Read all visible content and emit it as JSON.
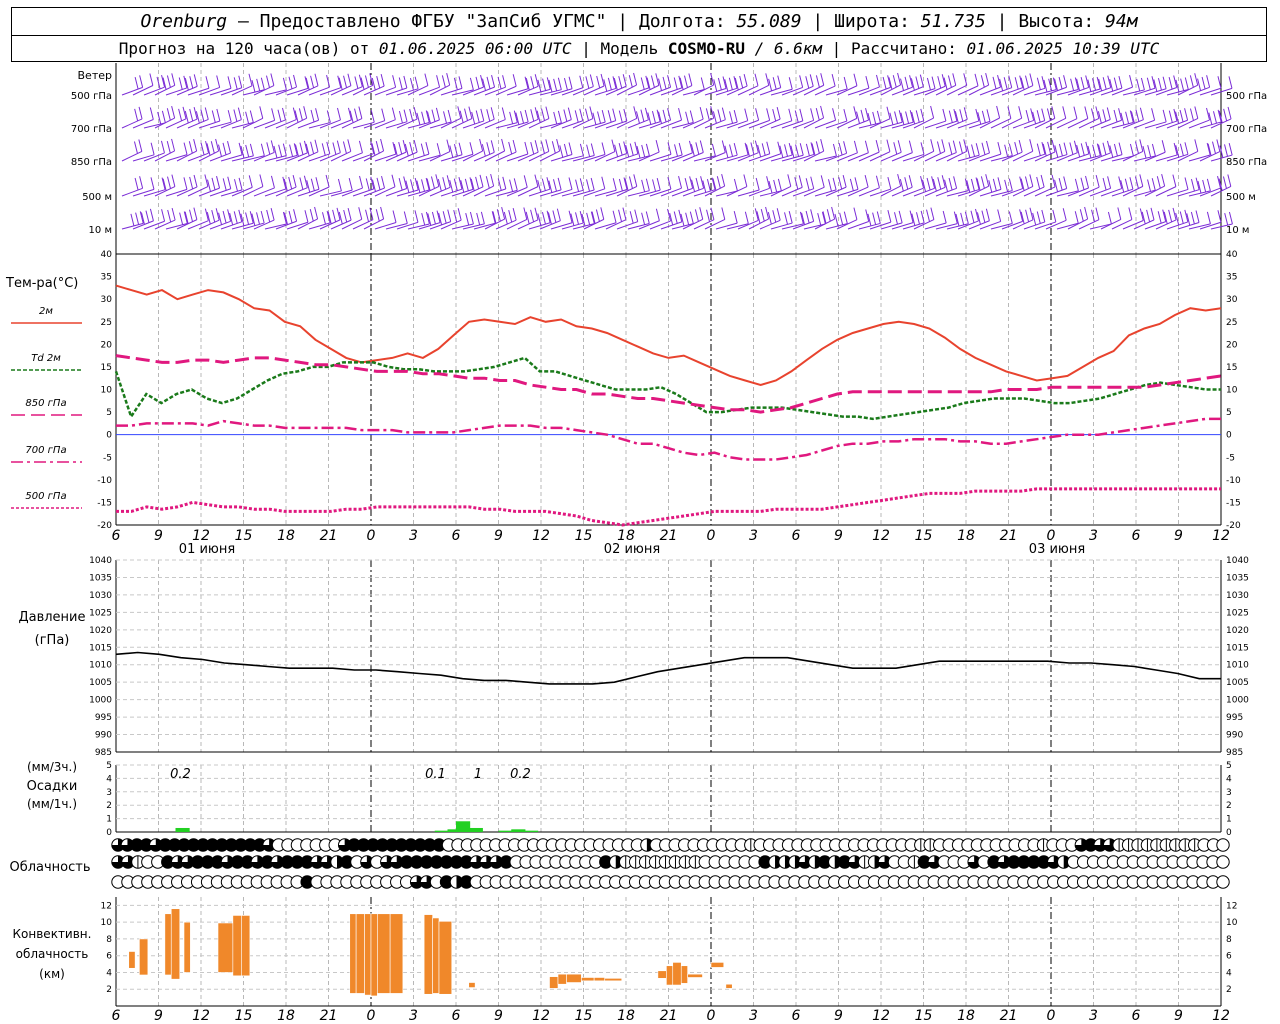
{
  "header": {
    "station": "Orenburg",
    "provider": "— Предоставлено ФГБУ \"ЗапСиб УГМС\"",
    "lon_label": "| Долгота:",
    "lon": "55.089",
    "lat_label": "| Широта:",
    "lat": "51.735",
    "alt_label": "| Высота:",
    "alt": "94м",
    "fc_label": "Прогноз на 120 часа(ов) от",
    "fc_time": "01.06.2025 06:00 UTC",
    "model_label": "| Модель",
    "model": "COSMO-RU",
    "model_res": "/ 6.6км",
    "calc_label": "| Рассчитано:",
    "calc_time": "01.06.2025 10:39 UTC"
  },
  "colors": {
    "wind": "#7b2cd6",
    "t2m": "#e8432e",
    "td2m": "#1a7a1a",
    "t850": "#e0187f",
    "t700": "#e0187f",
    "t500": "#e0187f",
    "pressure": "#000000",
    "precip": "#22d022",
    "convective": "#f0882a",
    "zero_line": "#3344ff"
  },
  "chart_data": {
    "type": "line",
    "x_ticks": [
      "6",
      "9",
      "12",
      "15",
      "18",
      "21",
      "0",
      "3",
      "6",
      "9",
      "12",
      "15",
      "18",
      "21",
      "0",
      "3",
      "6",
      "9",
      "12",
      "15",
      "18",
      "21",
      "0",
      "3",
      "6",
      "9",
      "12"
    ],
    "day_labels": [
      "01 июня",
      "02 июня",
      "03 июня"
    ],
    "wind": {
      "title": "Ветер",
      "levels": [
        "500 гПа",
        "700 гПа",
        "850 гПа",
        "500 м",
        "10 м"
      ]
    },
    "temperature": {
      "title": "Тем-ра(°C)",
      "ylim": [
        -20,
        40
      ],
      "y_ticks": [
        40,
        35,
        30,
        25,
        20,
        15,
        10,
        5,
        0,
        -5,
        -10,
        -15,
        -20
      ],
      "series": [
        {
          "name": "2м",
          "key": "t2m",
          "values": [
            33,
            32,
            31,
            32,
            30,
            31,
            32,
            31.5,
            30,
            28,
            27.5,
            25,
            24,
            21,
            19,
            17,
            16,
            16.5,
            17,
            18,
            17,
            19,
            22,
            25,
            25.5,
            25,
            24.5,
            26,
            25,
            25.5,
            24,
            23.5,
            22.5,
            21,
            19.5,
            18,
            17,
            17.5,
            16,
            14.5,
            13,
            12,
            11,
            12,
            14,
            16.5,
            19,
            21,
            22.5,
            23.5,
            24.5,
            25,
            24.5,
            23.5,
            21.5,
            19,
            17,
            15.5,
            14,
            13,
            12,
            12.5,
            13,
            15,
            17,
            18.5,
            22,
            23.5,
            24.5,
            26.5,
            28,
            27.5,
            28
          ]
        },
        {
          "name": "Td 2м",
          "key": "td2m",
          "values": [
            14,
            4,
            9,
            7,
            9,
            10,
            8,
            7,
            8,
            10,
            12,
            13.5,
            14,
            15,
            15,
            16,
            16,
            16,
            15,
            14.5,
            14.5,
            14,
            14,
            14,
            14.5,
            15,
            16,
            17,
            14,
            14,
            13,
            12,
            11,
            10,
            10,
            10,
            10.5,
            9,
            7,
            5,
            5,
            5.5,
            6,
            6,
            6,
            5.5,
            5,
            4.5,
            4,
            4,
            3.5,
            4,
            4.5,
            5,
            5.5,
            6,
            7,
            7.5,
            8,
            8,
            8,
            7.5,
            7,
            7,
            7.5,
            8,
            9,
            10,
            11,
            11.5,
            11,
            10.5,
            10,
            10
          ]
        },
        {
          "name": "850 гПа",
          "key": "t850",
          "values": [
            17.5,
            17,
            16.5,
            16,
            16,
            16.5,
            16.5,
            16,
            16.5,
            17,
            17,
            16.5,
            16,
            15.5,
            15.5,
            15,
            14.5,
            14,
            14,
            14,
            13.5,
            13.5,
            13,
            12.5,
            12.5,
            12,
            12,
            11,
            10.5,
            10,
            10,
            9,
            9,
            8.5,
            8,
            8,
            7.5,
            7,
            6.5,
            6,
            5.5,
            5.5,
            5,
            5.5,
            6,
            7,
            8,
            9,
            9.5,
            9.5,
            9.5,
            9.5,
            9.5,
            9.5,
            9.5,
            9.5,
            9.5,
            9.5,
            10,
            10,
            10,
            10.5,
            10.5,
            10.5,
            10.5,
            10.5,
            10.5,
            10.5,
            11,
            11.5,
            12,
            12.5,
            13
          ]
        },
        {
          "name": "700 гПа",
          "key": "t700",
          "values": [
            2,
            2,
            2.5,
            2.5,
            2.5,
            2.5,
            2,
            3,
            2.5,
            2,
            2,
            1.5,
            1.5,
            1.5,
            1.5,
            1.5,
            1,
            1,
            1,
            0.5,
            0.5,
            0.5,
            0.5,
            1,
            1.5,
            2,
            2,
            2,
            1.5,
            1.5,
            1,
            0.5,
            0,
            -1,
            -2,
            -2,
            -3,
            -4,
            -4.5,
            -4,
            -5,
            -5.5,
            -5.5,
            -5.5,
            -5,
            -4.5,
            -3.5,
            -2.5,
            -2,
            -2,
            -1.5,
            -1.5,
            -1,
            -1,
            -1,
            -1.5,
            -1.5,
            -2,
            -2,
            -1.5,
            -1,
            -0.5,
            0,
            0,
            0,
            0.5,
            1,
            1.5,
            2,
            2.5,
            3,
            3.5,
            3.5
          ]
        },
        {
          "name": "500 гПа",
          "key": "t500",
          "values": [
            -17,
            -17,
            -16,
            -16.5,
            -16,
            -15,
            -15.5,
            -16,
            -16,
            -16.5,
            -16.5,
            -17,
            -17,
            -17,
            -17,
            -16.5,
            -16.5,
            -16,
            -16,
            -16,
            -16,
            -16,
            -16,
            -16,
            -16.5,
            -16.5,
            -17,
            -17,
            -17,
            -17.5,
            -18,
            -19,
            -19.5,
            -20,
            -19.5,
            -19,
            -18.5,
            -18,
            -17.5,
            -17,
            -17,
            -17,
            -17,
            -16.5,
            -16.5,
            -16.5,
            -16.5,
            -16,
            -15.5,
            -15,
            -14.5,
            -14,
            -13.5,
            -13,
            -13,
            -13,
            -12.5,
            -12.5,
            -12.5,
            -12.5,
            -12,
            -12,
            -12,
            -12,
            -12,
            -12,
            -12,
            -12,
            -12,
            -12,
            -12,
            -12,
            -12
          ]
        }
      ]
    },
    "pressure": {
      "title": "Давление",
      "unit": "(гПа)",
      "ylim": [
        985,
        1040
      ],
      "y_ticks": [
        1040,
        1035,
        1030,
        1025,
        1020,
        1015,
        1010,
        1005,
        1000,
        995,
        990,
        985
      ],
      "values": [
        1013,
        1013.5,
        1013,
        1012,
        1011.5,
        1010.5,
        1010,
        1009.5,
        1009,
        1009,
        1009,
        1008.5,
        1008.5,
        1008,
        1007.5,
        1007,
        1006,
        1005.5,
        1005.5,
        1005,
        1004.5,
        1004.5,
        1004.5,
        1005,
        1006.5,
        1008,
        1009,
        1010,
        1011,
        1012,
        1012,
        1012,
        1011,
        1010,
        1009,
        1009,
        1009,
        1010,
        1011,
        1011,
        1011,
        1011,
        1011,
        1011,
        1010.5,
        1010.5,
        1010,
        1009.5,
        1008.5,
        1007.5,
        1006,
        1006
      ]
    },
    "precip": {
      "title": "Осадки",
      "unit_3h": "(мм/3ч.)",
      "unit_1h": "(мм/1ч.)",
      "ylim": [
        0,
        5
      ],
      "y_ticks": [
        5,
        4,
        3,
        2,
        1,
        0
      ],
      "labels": [
        {
          "x": 1,
          "text": "0.2"
        },
        {
          "x": 7,
          "text": "0.1"
        },
        {
          "x": 8,
          "text": "1"
        },
        {
          "x": 9,
          "text": "0.2"
        }
      ],
      "bars": [
        [
          1.4,
          0.3
        ],
        [
          7.5,
          0.1
        ],
        [
          7.8,
          0.2
        ],
        [
          8.0,
          0.8
        ],
        [
          8.3,
          0.3
        ],
        [
          9.0,
          0.1
        ],
        [
          9.3,
          0.2
        ],
        [
          9.6,
          0.1
        ]
      ]
    },
    "cloud": {
      "title": "Облачность",
      "rows": [
        [
          3,
          3,
          4,
          4,
          3,
          4,
          4,
          4,
          4,
          4,
          4,
          4,
          4,
          4,
          4,
          4,
          3,
          0,
          0,
          0,
          0,
          0,
          0,
          0,
          3,
          4,
          4,
          4,
          4,
          4,
          4,
          4,
          4,
          4,
          4,
          0,
          0,
          0,
          0,
          0,
          0,
          0,
          0,
          0,
          0,
          0,
          0,
          0,
          0,
          0,
          0,
          0,
          0,
          0,
          0,
          0,
          2,
          0,
          0,
          0,
          0,
          0,
          0,
          0,
          0,
          0,
          0,
          1,
          0,
          0,
          0,
          0,
          0,
          0,
          0,
          0,
          0,
          0,
          0,
          0,
          0,
          0,
          0,
          0,
          0,
          1,
          1,
          0,
          0,
          0,
          0,
          0,
          0,
          0,
          0,
          0,
          0,
          0,
          1,
          0,
          0,
          0,
          3,
          4,
          3,
          3,
          1,
          1,
          1,
          1,
          1,
          1,
          1,
          1,
          1,
          0,
          0,
          0
        ],
        [
          3,
          3,
          1,
          0,
          0,
          4,
          3,
          3,
          4,
          4,
          4,
          3,
          4,
          4,
          3,
          4,
          3,
          4,
          4,
          4,
          3,
          3,
          2,
          4,
          0,
          3,
          0,
          3,
          3,
          4,
          4,
          4,
          4,
          4,
          4,
          4,
          3,
          3,
          3,
          4,
          0,
          0,
          0,
          0,
          0,
          0,
          0,
          0,
          0,
          4,
          2,
          1,
          1,
          1,
          1,
          1,
          1,
          1,
          1,
          0,
          0,
          0,
          0,
          0,
          0,
          4,
          2,
          2,
          2,
          3,
          2,
          4,
          2,
          4,
          3,
          1,
          2,
          3,
          0,
          0,
          1,
          4,
          3,
          0,
          0,
          0,
          3,
          0,
          4,
          3,
          4,
          4,
          4,
          4,
          3,
          2,
          0,
          0,
          0,
          0,
          0,
          0,
          0,
          0,
          0,
          0,
          0,
          0,
          0,
          0,
          0,
          0
        ],
        [
          0,
          0,
          0,
          0,
          0,
          0,
          0,
          0,
          0,
          0,
          0,
          0,
          0,
          0,
          0,
          0,
          0,
          0,
          0,
          4,
          0,
          0,
          0,
          0,
          0,
          0,
          0,
          0,
          0,
          0,
          3,
          3,
          0,
          4,
          2,
          4,
          0,
          0,
          0,
          0,
          0,
          0,
          0,
          0,
          0,
          0,
          0,
          0,
          0,
          0,
          0,
          0,
          0,
          0,
          0,
          0,
          0,
          0,
          0,
          0,
          0,
          0,
          0,
          0,
          0,
          0,
          0,
          0,
          0,
          0,
          0,
          0,
          0,
          0,
          0,
          0,
          0,
          0,
          0,
          0,
          0,
          0,
          0,
          0,
          0,
          0,
          0,
          0,
          0,
          0,
          0,
          0,
          0,
          0,
          0,
          0,
          0,
          0,
          0,
          0,
          0,
          0,
          0,
          0,
          0,
          0,
          0,
          0,
          0,
          0,
          0,
          0
        ]
      ]
    },
    "convective": {
      "title": "Конвективн.",
      "title2": "облачность",
      "unit": "(км)",
      "ylim": [
        0,
        13
      ],
      "y_ticks": [
        12,
        10,
        8,
        6,
        4,
        2
      ],
      "bars": [
        [
          0.6,
          0.9,
          4.5,
          6.5
        ],
        [
          1.1,
          1.5,
          3.7,
          8.0
        ],
        [
          2.3,
          2.6,
          3.7,
          11.0
        ],
        [
          2.6,
          3.0,
          3.2,
          11.6
        ],
        [
          3.2,
          3.5,
          4.0,
          10.0
        ],
        [
          4.8,
          5.5,
          4.0,
          9.9
        ],
        [
          5.5,
          5.9,
          3.6,
          10.8
        ],
        [
          5.9,
          6.3,
          3.6,
          10.8
        ],
        [
          11.0,
          11.3,
          1.5,
          11.0
        ],
        [
          11.3,
          11.7,
          1.5,
          11.0
        ],
        [
          11.7,
          12.0,
          1.3,
          11.0
        ],
        [
          12.0,
          12.3,
          1.2,
          11.0
        ],
        [
          12.3,
          12.9,
          1.5,
          11.0
        ],
        [
          12.9,
          13.5,
          1.5,
          11.0
        ],
        [
          14.5,
          14.9,
          1.4,
          10.9
        ],
        [
          14.9,
          15.2,
          1.5,
          10.5
        ],
        [
          15.2,
          15.8,
          1.4,
          10.1
        ],
        [
          16.6,
          16.9,
          2.2,
          2.8
        ],
        [
          20.4,
          20.8,
          2.1,
          3.5
        ],
        [
          20.8,
          21.2,
          2.6,
          3.8
        ],
        [
          21.2,
          21.9,
          2.8,
          3.8
        ],
        [
          21.9,
          22.5,
          3.0,
          3.4
        ],
        [
          22.5,
          23.0,
          3.0,
          3.4
        ],
        [
          23.0,
          23.8,
          3.0,
          3.3
        ],
        [
          25.5,
          25.9,
          3.3,
          4.2
        ],
        [
          25.9,
          26.2,
          2.5,
          4.8
        ],
        [
          26.2,
          26.6,
          2.5,
          5.2
        ],
        [
          26.6,
          26.9,
          2.7,
          4.8
        ],
        [
          26.9,
          27.6,
          3.4,
          3.8
        ],
        [
          28.0,
          28.6,
          4.6,
          5.2
        ],
        [
          28.7,
          29.0,
          2.1,
          2.6
        ]
      ]
    }
  }
}
